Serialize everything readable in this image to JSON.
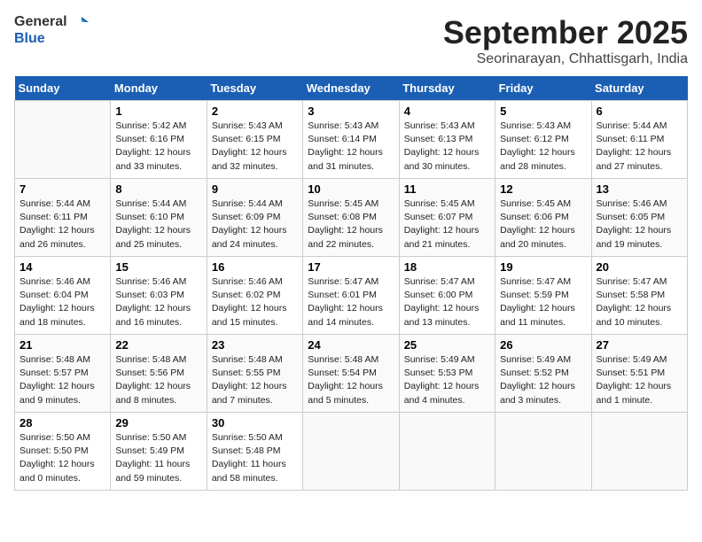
{
  "logo": {
    "general": "General",
    "blue": "Blue"
  },
  "title": "September 2025",
  "subtitle": "Seorinarayan, Chhattisgarh, India",
  "weekdays": [
    "Sunday",
    "Monday",
    "Tuesday",
    "Wednesday",
    "Thursday",
    "Friday",
    "Saturday"
  ],
  "weeks": [
    [
      {
        "day": "",
        "sunrise": "",
        "sunset": "",
        "daylight": ""
      },
      {
        "day": "1",
        "sunrise": "Sunrise: 5:42 AM",
        "sunset": "Sunset: 6:16 PM",
        "daylight": "Daylight: 12 hours and 33 minutes."
      },
      {
        "day": "2",
        "sunrise": "Sunrise: 5:43 AM",
        "sunset": "Sunset: 6:15 PM",
        "daylight": "Daylight: 12 hours and 32 minutes."
      },
      {
        "day": "3",
        "sunrise": "Sunrise: 5:43 AM",
        "sunset": "Sunset: 6:14 PM",
        "daylight": "Daylight: 12 hours and 31 minutes."
      },
      {
        "day": "4",
        "sunrise": "Sunrise: 5:43 AM",
        "sunset": "Sunset: 6:13 PM",
        "daylight": "Daylight: 12 hours and 30 minutes."
      },
      {
        "day": "5",
        "sunrise": "Sunrise: 5:43 AM",
        "sunset": "Sunset: 6:12 PM",
        "daylight": "Daylight: 12 hours and 28 minutes."
      },
      {
        "day": "6",
        "sunrise": "Sunrise: 5:44 AM",
        "sunset": "Sunset: 6:11 PM",
        "daylight": "Daylight: 12 hours and 27 minutes."
      }
    ],
    [
      {
        "day": "7",
        "sunrise": "Sunrise: 5:44 AM",
        "sunset": "Sunset: 6:11 PM",
        "daylight": "Daylight: 12 hours and 26 minutes."
      },
      {
        "day": "8",
        "sunrise": "Sunrise: 5:44 AM",
        "sunset": "Sunset: 6:10 PM",
        "daylight": "Daylight: 12 hours and 25 minutes."
      },
      {
        "day": "9",
        "sunrise": "Sunrise: 5:44 AM",
        "sunset": "Sunset: 6:09 PM",
        "daylight": "Daylight: 12 hours and 24 minutes."
      },
      {
        "day": "10",
        "sunrise": "Sunrise: 5:45 AM",
        "sunset": "Sunset: 6:08 PM",
        "daylight": "Daylight: 12 hours and 22 minutes."
      },
      {
        "day": "11",
        "sunrise": "Sunrise: 5:45 AM",
        "sunset": "Sunset: 6:07 PM",
        "daylight": "Daylight: 12 hours and 21 minutes."
      },
      {
        "day": "12",
        "sunrise": "Sunrise: 5:45 AM",
        "sunset": "Sunset: 6:06 PM",
        "daylight": "Daylight: 12 hours and 20 minutes."
      },
      {
        "day": "13",
        "sunrise": "Sunrise: 5:46 AM",
        "sunset": "Sunset: 6:05 PM",
        "daylight": "Daylight: 12 hours and 19 minutes."
      }
    ],
    [
      {
        "day": "14",
        "sunrise": "Sunrise: 5:46 AM",
        "sunset": "Sunset: 6:04 PM",
        "daylight": "Daylight: 12 hours and 18 minutes."
      },
      {
        "day": "15",
        "sunrise": "Sunrise: 5:46 AM",
        "sunset": "Sunset: 6:03 PM",
        "daylight": "Daylight: 12 hours and 16 minutes."
      },
      {
        "day": "16",
        "sunrise": "Sunrise: 5:46 AM",
        "sunset": "Sunset: 6:02 PM",
        "daylight": "Daylight: 12 hours and 15 minutes."
      },
      {
        "day": "17",
        "sunrise": "Sunrise: 5:47 AM",
        "sunset": "Sunset: 6:01 PM",
        "daylight": "Daylight: 12 hours and 14 minutes."
      },
      {
        "day": "18",
        "sunrise": "Sunrise: 5:47 AM",
        "sunset": "Sunset: 6:00 PM",
        "daylight": "Daylight: 12 hours and 13 minutes."
      },
      {
        "day": "19",
        "sunrise": "Sunrise: 5:47 AM",
        "sunset": "Sunset: 5:59 PM",
        "daylight": "Daylight: 12 hours and 11 minutes."
      },
      {
        "day": "20",
        "sunrise": "Sunrise: 5:47 AM",
        "sunset": "Sunset: 5:58 PM",
        "daylight": "Daylight: 12 hours and 10 minutes."
      }
    ],
    [
      {
        "day": "21",
        "sunrise": "Sunrise: 5:48 AM",
        "sunset": "Sunset: 5:57 PM",
        "daylight": "Daylight: 12 hours and 9 minutes."
      },
      {
        "day": "22",
        "sunrise": "Sunrise: 5:48 AM",
        "sunset": "Sunset: 5:56 PM",
        "daylight": "Daylight: 12 hours and 8 minutes."
      },
      {
        "day": "23",
        "sunrise": "Sunrise: 5:48 AM",
        "sunset": "Sunset: 5:55 PM",
        "daylight": "Daylight: 12 hours and 7 minutes."
      },
      {
        "day": "24",
        "sunrise": "Sunrise: 5:48 AM",
        "sunset": "Sunset: 5:54 PM",
        "daylight": "Daylight: 12 hours and 5 minutes."
      },
      {
        "day": "25",
        "sunrise": "Sunrise: 5:49 AM",
        "sunset": "Sunset: 5:53 PM",
        "daylight": "Daylight: 12 hours and 4 minutes."
      },
      {
        "day": "26",
        "sunrise": "Sunrise: 5:49 AM",
        "sunset": "Sunset: 5:52 PM",
        "daylight": "Daylight: 12 hours and 3 minutes."
      },
      {
        "day": "27",
        "sunrise": "Sunrise: 5:49 AM",
        "sunset": "Sunset: 5:51 PM",
        "daylight": "Daylight: 12 hours and 1 minute."
      }
    ],
    [
      {
        "day": "28",
        "sunrise": "Sunrise: 5:50 AM",
        "sunset": "Sunset: 5:50 PM",
        "daylight": "Daylight: 12 hours and 0 minutes."
      },
      {
        "day": "29",
        "sunrise": "Sunrise: 5:50 AM",
        "sunset": "Sunset: 5:49 PM",
        "daylight": "Daylight: 11 hours and 59 minutes."
      },
      {
        "day": "30",
        "sunrise": "Sunrise: 5:50 AM",
        "sunset": "Sunset: 5:48 PM",
        "daylight": "Daylight: 11 hours and 58 minutes."
      },
      {
        "day": "",
        "sunrise": "",
        "sunset": "",
        "daylight": ""
      },
      {
        "day": "",
        "sunrise": "",
        "sunset": "",
        "daylight": ""
      },
      {
        "day": "",
        "sunrise": "",
        "sunset": "",
        "daylight": ""
      },
      {
        "day": "",
        "sunrise": "",
        "sunset": "",
        "daylight": ""
      }
    ]
  ]
}
